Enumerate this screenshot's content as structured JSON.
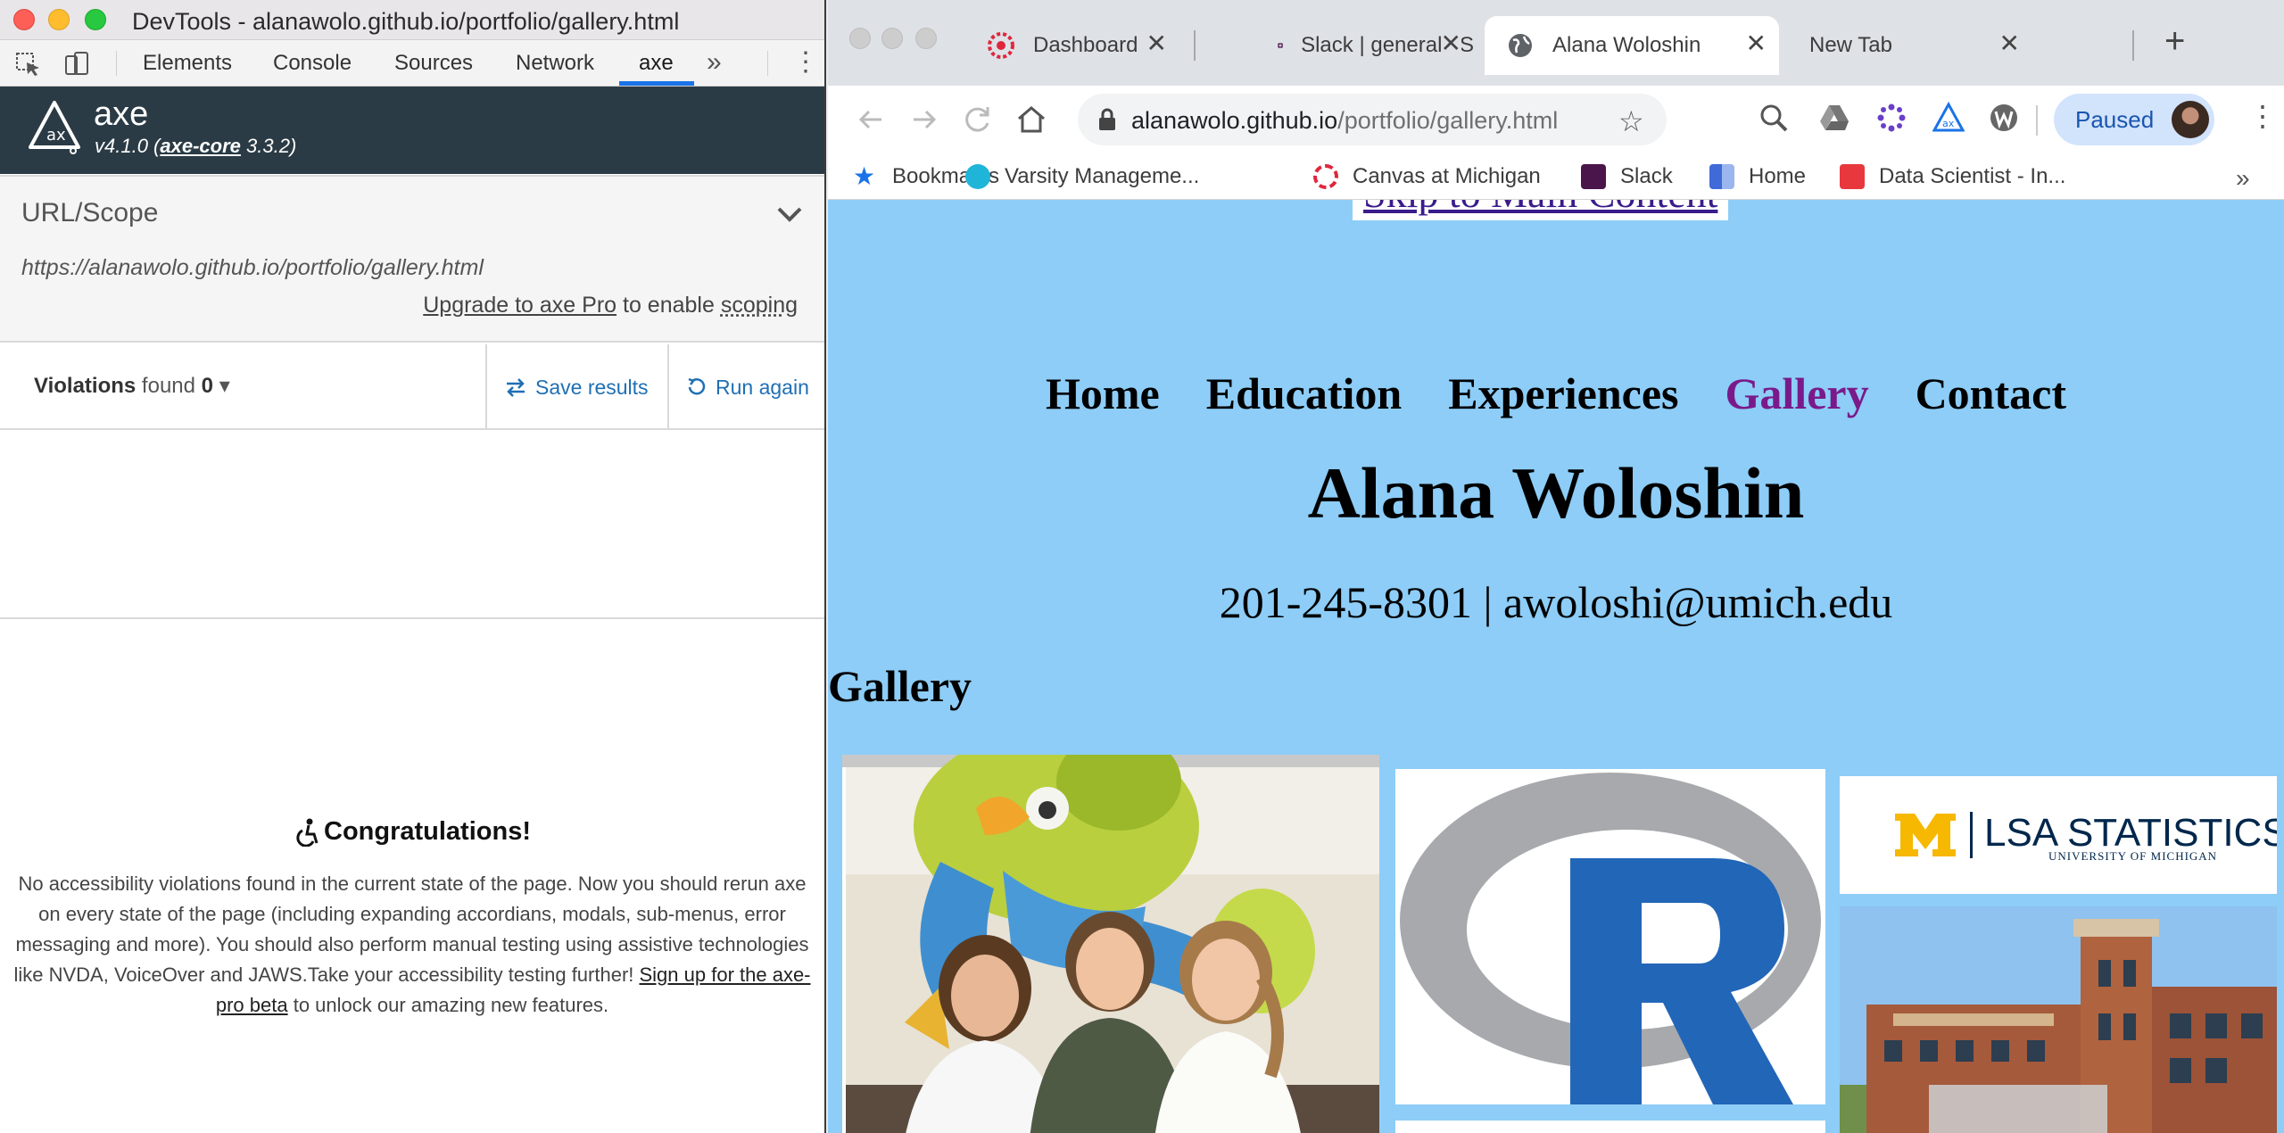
{
  "devtools": {
    "window_title": "DevTools - alanawolo.github.io/portfolio/gallery.html",
    "tabs": [
      {
        "label": "Elements",
        "active": false
      },
      {
        "label": "Console",
        "active": false
      },
      {
        "label": "Sources",
        "active": false
      },
      {
        "label": "Network",
        "active": false
      },
      {
        "label": "axe",
        "active": true
      }
    ],
    "more_tabs_glyph": "»",
    "menu_glyph": "⋮",
    "accent_color": "#1a73e8"
  },
  "axe": {
    "name": "axe",
    "version": "v4.1.0",
    "core_label": "axe-core",
    "core_version": "3.3.2",
    "header_bg": "#2b3b45",
    "scope": {
      "label": "URL/Scope",
      "url": "https://alanawolo.github.io/portfolio/gallery.html",
      "upgrade_link": "Upgrade to axe Pro",
      "upgrade_middle": "to enable",
      "upgrade_feature": "scoping"
    },
    "violations": {
      "label": "Violations",
      "found_text": "found",
      "count": "0"
    },
    "save_results_label": "Save results",
    "run_again_label": "Run again",
    "congrats": {
      "title": "Congratulations!",
      "body": "No accessibility violations found in the current state of the page. Now you should rerun axe on every state of the page (including expanding accordians, modals, sub-menus, error messaging and more). You should also perform manual testing using assistive technologies like NVDA, VoiceOver and JAWS.Take your accessibility testing further! ",
      "signup_link": "Sign up for the axe-pro beta",
      "suffix": " to unlock our amazing new features."
    }
  },
  "browser": {
    "tabs": [
      {
        "title": "Dashboard",
        "icon": "canvas-icon",
        "active": false
      },
      {
        "title": "Slack | general | S",
        "icon": "slack-icon",
        "active": false
      },
      {
        "title": "Alana Woloshin",
        "icon": "globe-icon",
        "active": true
      },
      {
        "title": "New Tab",
        "icon": "",
        "active": false
      }
    ],
    "url_host": "alanawolo.github.io",
    "url_path": "/portfolio/gallery.html",
    "profile_status": "Paused",
    "bookmarks": [
      {
        "label": "Bookmarks",
        "icon": "star-icon",
        "color": "#1a73e8"
      },
      {
        "label": "Varsity Manageme...",
        "icon": "varsity-icon",
        "color": "#1fb5d9"
      },
      {
        "label": "Canvas at Michigan",
        "icon": "canvas-icon",
        "color": "#e0263c"
      },
      {
        "label": "Slack",
        "icon": "slack-icon",
        "color": "#4a154b"
      },
      {
        "label": "Home",
        "icon": "home-bookmark-icon",
        "color": "#3f6ad8"
      },
      {
        "label": "Data Scientist - In...",
        "icon": "handshake-icon",
        "color": "#e8383d"
      }
    ],
    "bookmarks_overflow": "»"
  },
  "page": {
    "background": "#8dcdf7",
    "skip_link": "Skip to Main Content",
    "nav": [
      {
        "label": "Home",
        "current": false
      },
      {
        "label": "Education",
        "current": false
      },
      {
        "label": "Experiences",
        "current": false
      },
      {
        "label": "Gallery",
        "current": true
      },
      {
        "label": "Contact",
        "current": false
      }
    ],
    "name": "Alana Woloshin",
    "contact": "201-245-8301 | awoloshi@umich.edu",
    "gallery_heading": "Gallery",
    "lsa_logo_text": {
      "main": "LSA STATISTICS",
      "sub": "UNIVERSITY OF MICHIGAN"
    }
  }
}
